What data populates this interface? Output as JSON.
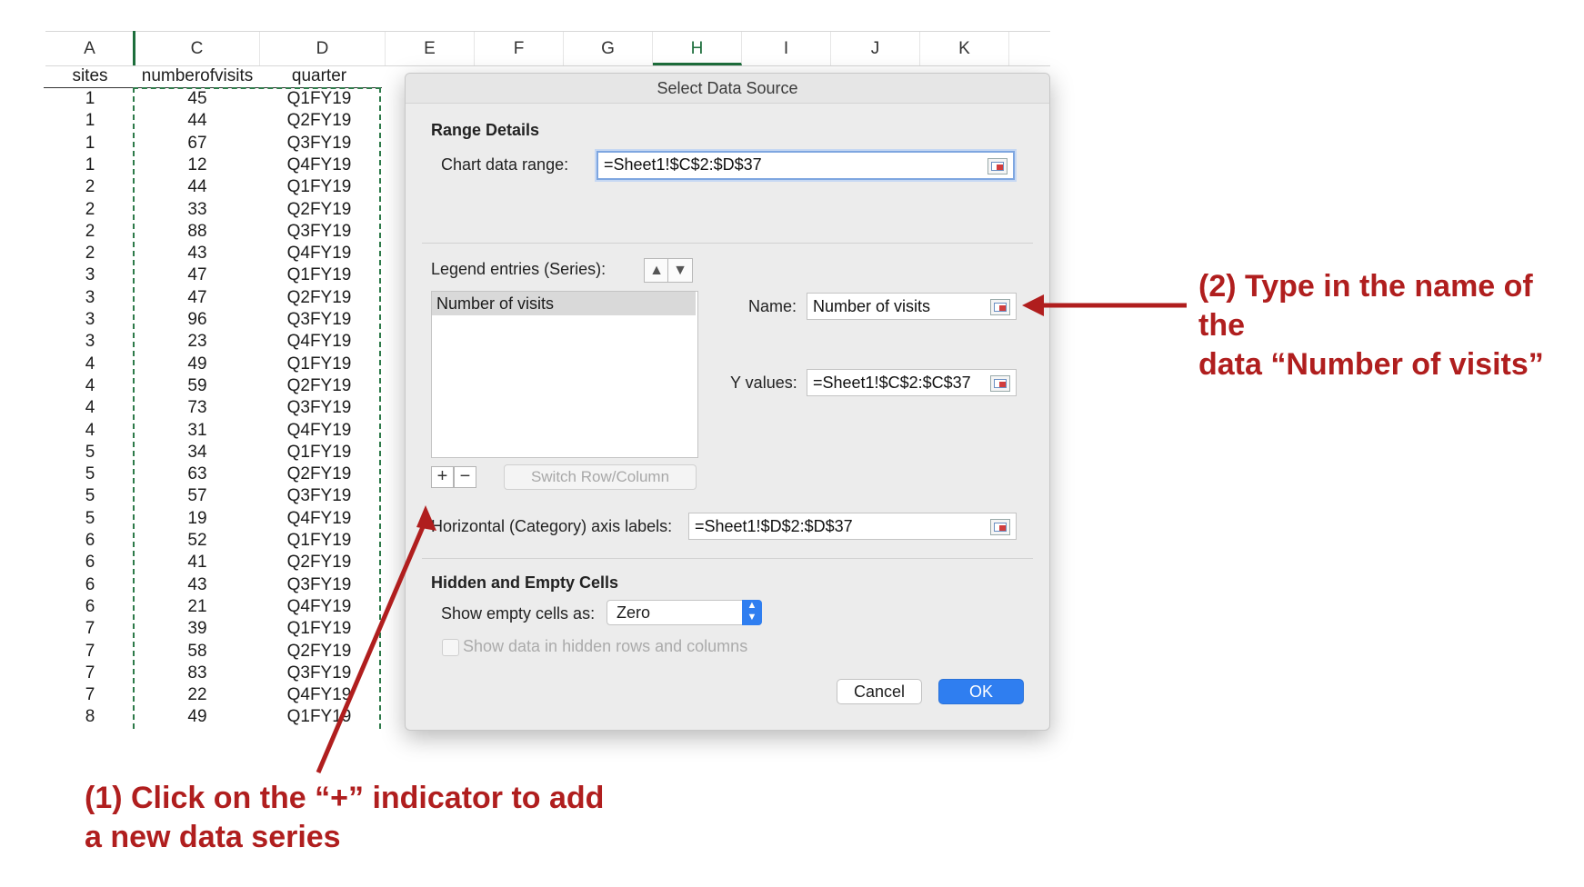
{
  "sheet": {
    "columns": [
      "A",
      "C",
      "D",
      "E",
      "F",
      "G",
      "H",
      "I",
      "J",
      "K"
    ],
    "selected_column": "H",
    "headers": {
      "a": "sites",
      "c": "numberofvisits",
      "d": "quarter"
    },
    "rows": [
      [
        "1",
        "45",
        "Q1FY19"
      ],
      [
        "1",
        "44",
        "Q2FY19"
      ],
      [
        "1",
        "67",
        "Q3FY19"
      ],
      [
        "1",
        "12",
        "Q4FY19"
      ],
      [
        "2",
        "44",
        "Q1FY19"
      ],
      [
        "2",
        "33",
        "Q2FY19"
      ],
      [
        "2",
        "88",
        "Q3FY19"
      ],
      [
        "2",
        "43",
        "Q4FY19"
      ],
      [
        "3",
        "47",
        "Q1FY19"
      ],
      [
        "3",
        "47",
        "Q2FY19"
      ],
      [
        "3",
        "96",
        "Q3FY19"
      ],
      [
        "3",
        "23",
        "Q4FY19"
      ],
      [
        "4",
        "49",
        "Q1FY19"
      ],
      [
        "4",
        "59",
        "Q2FY19"
      ],
      [
        "4",
        "73",
        "Q3FY19"
      ],
      [
        "4",
        "31",
        "Q4FY19"
      ],
      [
        "5",
        "34",
        "Q1FY19"
      ],
      [
        "5",
        "63",
        "Q2FY19"
      ],
      [
        "5",
        "57",
        "Q3FY19"
      ],
      [
        "5",
        "19",
        "Q4FY19"
      ],
      [
        "6",
        "52",
        "Q1FY19"
      ],
      [
        "6",
        "41",
        "Q2FY19"
      ],
      [
        "6",
        "43",
        "Q3FY19"
      ],
      [
        "6",
        "21",
        "Q4FY19"
      ],
      [
        "7",
        "39",
        "Q1FY19"
      ],
      [
        "7",
        "58",
        "Q2FY19"
      ],
      [
        "7",
        "83",
        "Q3FY19"
      ],
      [
        "7",
        "22",
        "Q4FY19"
      ],
      [
        "8",
        "49",
        "Q1FY19"
      ]
    ]
  },
  "dialog": {
    "title": "Select Data Source",
    "range_details": "Range Details",
    "chart_range_label": "Chart data range:",
    "chart_range_value": "=Sheet1!$C$2:$D$37",
    "legend_label": "Legend entries (Series):",
    "series": [
      "Number of visits"
    ],
    "name_label": "Name:",
    "name_value": "Number of visits",
    "y_label": "Y values:",
    "y_value": "=Sheet1!$C$2:$C$37",
    "add_symbol": "+",
    "remove_symbol": "−",
    "switch_label": "Switch Row/Column",
    "axis_label": "Horizontal (Category) axis labels:",
    "axis_value": "=Sheet1!$D$2:$D$37",
    "hidden_title": "Hidden and Empty Cells",
    "empty_label": "Show empty cells as:",
    "empty_value": "Zero",
    "hidden_check_label": "Show data in hidden rows and columns",
    "cancel": "Cancel",
    "ok": "OK"
  },
  "annotations": {
    "step1_line1": "(1) Click on the “+” indicator to add",
    "step1_line2": "a new data series",
    "step2_line1": "(2) Type in the name of the",
    "step2_line2": "data “Number of visits”",
    "color": "#b01e1e"
  }
}
